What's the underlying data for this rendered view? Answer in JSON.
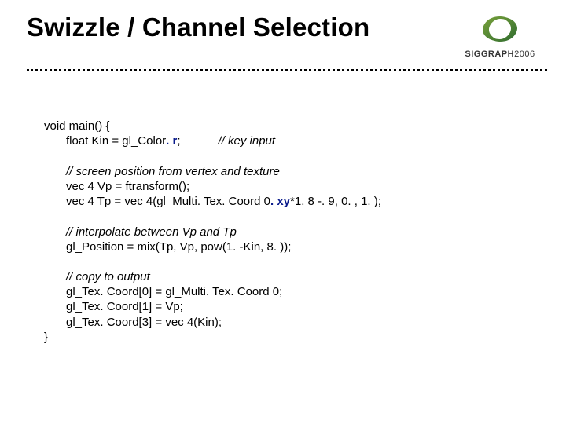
{
  "title": "Swizzle / Channel Selection",
  "brand": {
    "name_bold": "SIGGRAPH",
    "name_year": "2006"
  },
  "code": {
    "l1": "void main() {",
    "l2a": "float Kin = gl_Color",
    "l2_sw": ". r",
    "l2b": ";",
    "l2_cm": "// key input",
    "l3_cm": "// screen position from vertex and texture",
    "l4": "vec 4 Vp = ftransform();",
    "l5a": "vec 4 Tp = vec 4(gl_Multi. Tex. Coord 0",
    "l5_sw": ". xy",
    "l5b": "*1. 8 -. 9, 0. , 1. );",
    "l6_cm": "// interpolate between Vp and Tp",
    "l7": "gl_Position = mix(Tp, Vp, pow(1. -Kin, 8. ));",
    "l8_cm": "// copy to output",
    "l9": "gl_Tex. Coord[0] = gl_Multi. Tex. Coord 0;",
    "l10": "gl_Tex. Coord[1] = Vp;",
    "l11": "gl_Tex. Coord[3] = vec 4(Kin);",
    "l12": "}"
  }
}
